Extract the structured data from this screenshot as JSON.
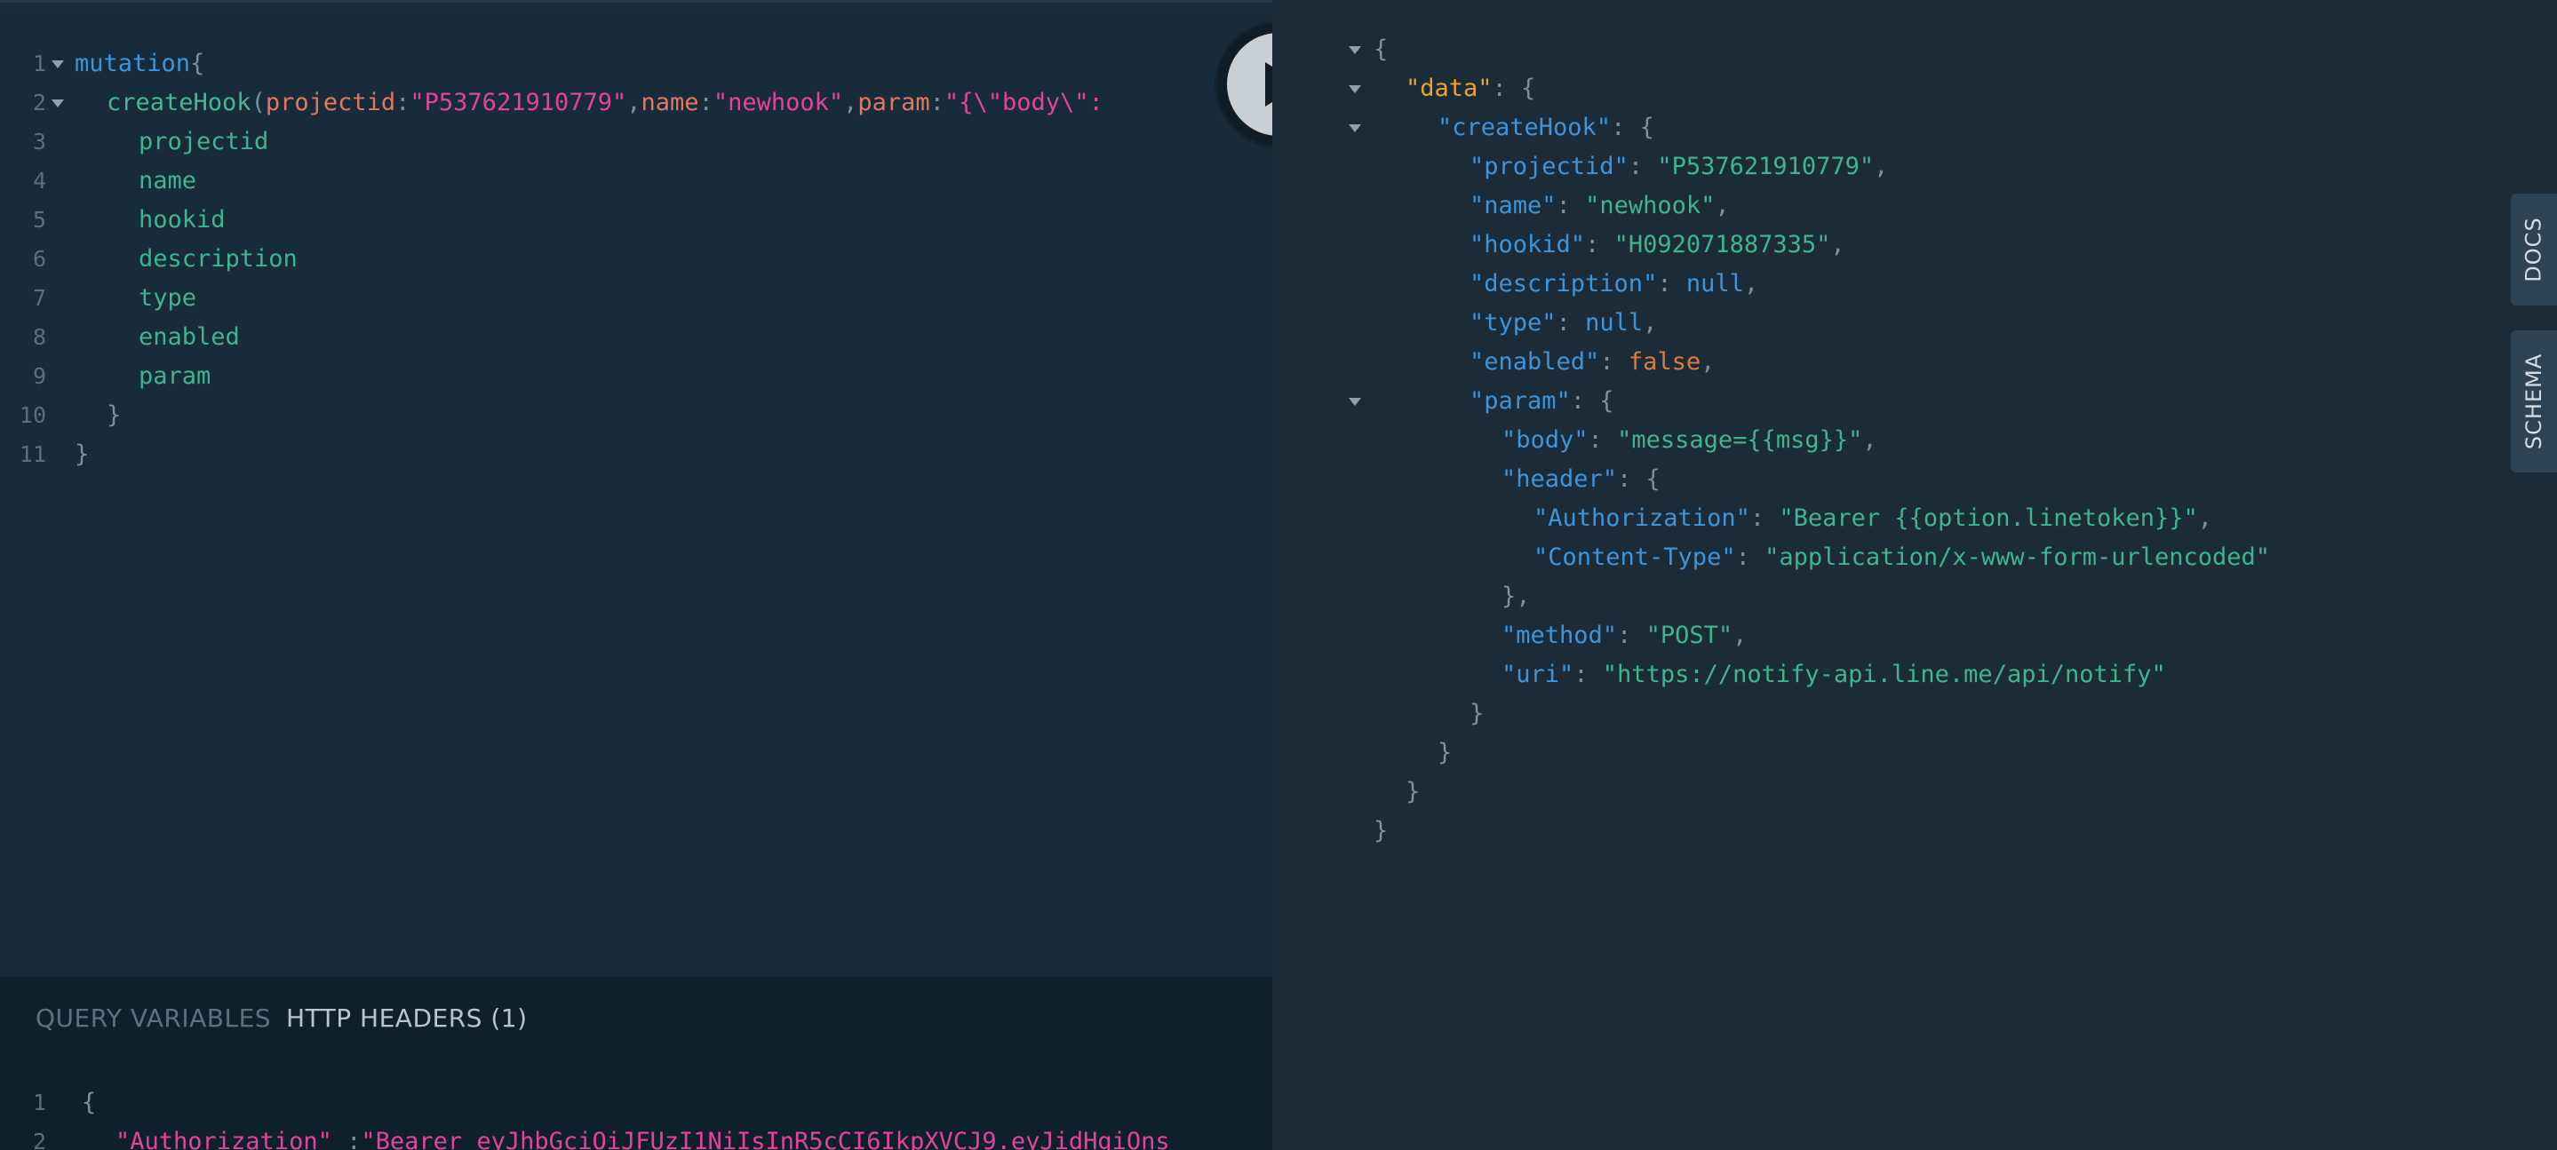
{
  "query_editor": {
    "line_numbers": [
      "1",
      "2",
      "3",
      "4",
      "5",
      "6",
      "7",
      "8",
      "9",
      "10",
      "11"
    ],
    "line1": {
      "keyword": "mutation",
      "brace": "{"
    },
    "line2": {
      "fn": "createHook",
      "open": "(",
      "arg1": "projectid",
      "c1": ":",
      "v1": "\"P537621910779\"",
      "comma1": ",",
      "arg2": "name",
      "c2": ":",
      "v2": "\"newhook\"",
      "comma2": ",",
      "arg3": "param",
      "c3": ":",
      "v3": "\"{\\\"body\\\":"
    },
    "fields": [
      "projectid",
      "name",
      "hookid",
      "description",
      "type",
      "enabled",
      "param"
    ],
    "close_inner": "}",
    "close_outer": "}"
  },
  "execute_button": {
    "icon": "play-icon"
  },
  "variables_pane": {
    "tab_query_variables": "QUERY VARIABLES",
    "tab_http_headers": "HTTP HEADERS (1)",
    "line_numbers": [
      "1",
      "2"
    ],
    "line1": "{",
    "line2_key": "\"Authorization\"",
    "line2_sep": " :",
    "line2_value": "\"Bearer eyJhbGciOiJFUzI1NiIsInR5cCI6IkpXVCJ9.eyJidHgiOns"
  },
  "result": {
    "open": "{",
    "data_key": "\"data\"",
    "createHook_key": "\"createHook\"",
    "projectid_key": "\"projectid\"",
    "projectid_val": "\"P537621910779\"",
    "name_key": "\"name\"",
    "name_val": "\"newhook\"",
    "hookid_key": "\"hookid\"",
    "hookid_val": "\"H092071887335\"",
    "description_key": "\"description\"",
    "description_val": "null",
    "type_key": "\"type\"",
    "type_val": "null",
    "enabled_key": "\"enabled\"",
    "enabled_val": "false",
    "param_key": "\"param\"",
    "body_key": "\"body\"",
    "body_val": "\"message={{msg}}\"",
    "header_key": "\"header\"",
    "auth_key": "\"Authorization\"",
    "auth_val": "\"Bearer {{option.linetoken}}\"",
    "ctype_key": "\"Content-Type\"",
    "ctype_val": "\"application/x-www-form-urlencoded\"",
    "header_close": "},",
    "method_key": "\"method\"",
    "method_val": "\"POST\"",
    "uri_key": "\"uri\"",
    "uri_val": "\"https://notify-api.line.me/api/notify\"",
    "close": "}"
  },
  "side_tabs": {
    "docs": "DOCS",
    "schema": "SCHEMA"
  }
}
